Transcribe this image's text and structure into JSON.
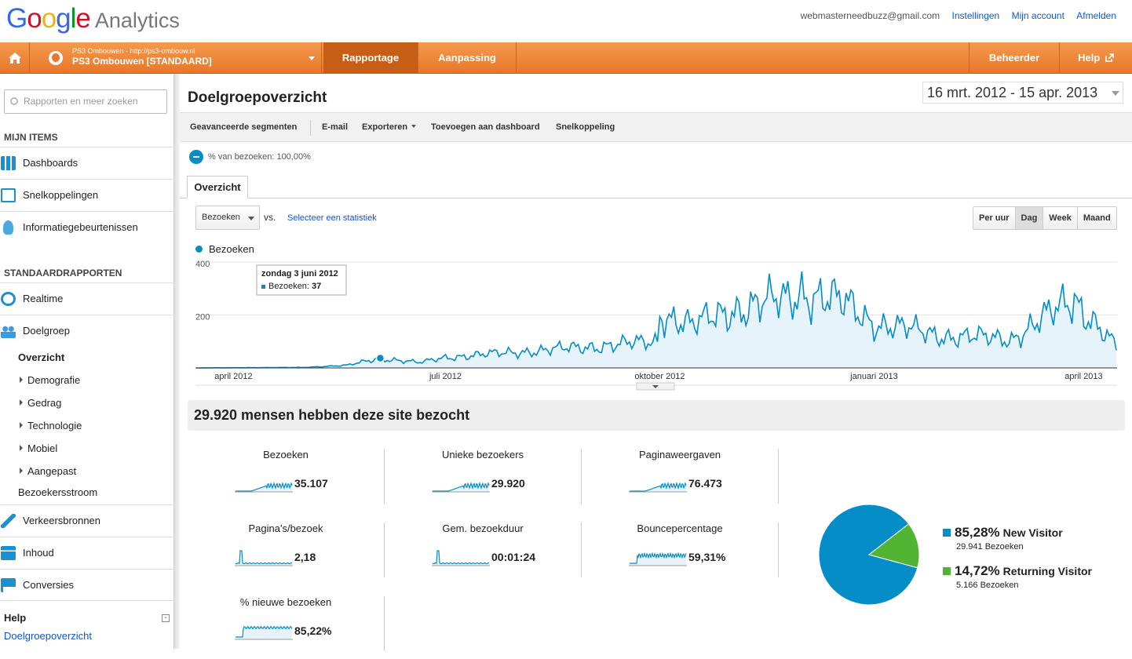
{
  "header": {
    "logo_google": "Google",
    "logo_product": "Analytics",
    "email": "webmasterneedbuzz@gmail.com",
    "links": [
      "Instellingen",
      "Mijn account",
      "Afmelden"
    ]
  },
  "nav": {
    "property_small": "PS3 Ombouwen - http://ps3-ombouw.nl",
    "property_name": "PS3 Ombouwen [STANDAARD]",
    "tab_reporting": "Rapportage",
    "tab_customization": "Aanpassing",
    "admin": "Beheerder",
    "help": "Help",
    "accent": "#e8772a"
  },
  "sidebar": {
    "search_placeholder": "Rapporten en meer zoeken",
    "my_items_title": "MIJN ITEMS",
    "my_items": [
      {
        "label": "Dashboards",
        "icon": "dashboard-icon"
      },
      {
        "label": "Snelkoppelingen",
        "icon": "shortcut-icon"
      },
      {
        "label": "Informatiegebeurtenissen",
        "icon": "lightbulb-icon"
      }
    ],
    "standard_title": "STANDAARDRAPPORTEN",
    "standard": [
      {
        "label": "Realtime",
        "icon": "realtime-icon"
      },
      {
        "label": "Doelgroep",
        "icon": "audience-icon"
      }
    ],
    "audience_sub": {
      "overview": "Overzicht",
      "items": [
        "Demografie",
        "Gedrag",
        "Technologie",
        "Mobiel",
        "Aangepast"
      ],
      "flow": "Bezoekersstroom"
    },
    "other": [
      {
        "label": "Verkeersbronnen",
        "icon": "traffic-icon"
      },
      {
        "label": "Inhoud",
        "icon": "content-icon"
      },
      {
        "label": "Conversies",
        "icon": "flag-icon"
      }
    ],
    "help_title": "Help",
    "help_link": "Doelgroepoverzicht"
  },
  "main": {
    "title": "Doelgroepoverzicht",
    "date_range": "16 mrt. 2012 - 15 apr. 2013",
    "toolbar": [
      "Geavanceerde segmenten",
      "E-mail",
      "Exporteren",
      "Toevoegen aan dashboard",
      "Snelkoppeling"
    ],
    "segment": "% van bezoeken: 100,00%",
    "tab": "Overzicht",
    "metric_select": "Bezoeken",
    "vs": "vs.",
    "select_stat": "Selecteer een statistiek",
    "granularity": [
      "Per uur",
      "Dag",
      "Week",
      "Maand"
    ],
    "granularity_active": "Dag",
    "summary": "29.920 mensen hebben deze site bezocht"
  },
  "chart_data": {
    "type": "line",
    "series": [
      {
        "name": "Bezoeken"
      }
    ],
    "y_ticks": [
      "400",
      "200"
    ],
    "ylim": [
      0,
      400
    ],
    "x_tick_labels": [
      "april 2012",
      "juli 2012",
      "oktober 2012",
      "januari 2013",
      "april 2013"
    ],
    "x_range": [
      "2012-03-16",
      "2013-04-15"
    ],
    "line_color": "#058dc7",
    "fill_color": "#e6f3fa",
    "tooltip": {
      "date": "zondag 3 juni 2012",
      "label": "Bezoeken:",
      "value": "37"
    },
    "approx_values": [
      {
        "date": "2012-03-16",
        "value": 0
      },
      {
        "date": "2012-05-01",
        "value": 2
      },
      {
        "date": "2012-05-20",
        "value": 10
      },
      {
        "date": "2012-06-03",
        "value": 37
      },
      {
        "date": "2012-06-20",
        "value": 20
      },
      {
        "date": "2012-07-01",
        "value": 40
      },
      {
        "date": "2012-08-01",
        "value": 60
      },
      {
        "date": "2012-09-01",
        "value": 80
      },
      {
        "date": "2012-09-30",
        "value": 100
      },
      {
        "date": "2012-10-01",
        "value": 210
      },
      {
        "date": "2012-10-15",
        "value": 160
      },
      {
        "date": "2012-11-01",
        "value": 220
      },
      {
        "date": "2012-11-25",
        "value": 260
      },
      {
        "date": "2012-12-01",
        "value": 290
      },
      {
        "date": "2012-12-20",
        "value": 240
      },
      {
        "date": "2013-01-01",
        "value": 170
      },
      {
        "date": "2013-02-01",
        "value": 120
      },
      {
        "date": "2013-03-01",
        "value": 110
      },
      {
        "date": "2013-03-28",
        "value": 260
      },
      {
        "date": "2013-04-15",
        "value": 80
      }
    ]
  },
  "metrics": [
    {
      "label": "Bezoeken",
      "value": "35.107"
    },
    {
      "label": "Unieke bezoekers",
      "value": "29.920"
    },
    {
      "label": "Paginaweergaven",
      "value": "76.473"
    },
    {
      "label": "Pagina's/bezoek",
      "value": "2,18"
    },
    {
      "label": "Gem. bezoekduur",
      "value": "00:01:24"
    },
    {
      "label": "Bouncepercentage",
      "value": "59,31%"
    },
    {
      "label": "% nieuwe bezoeken",
      "value": "85,22%"
    }
  ],
  "visitor_pie": {
    "type": "pie",
    "slices": [
      {
        "pct": "85,28%",
        "name": "New Visitor",
        "count": "29.941 Bezoeken",
        "value": 85.28,
        "color": "#058dc7"
      },
      {
        "pct": "14,72%",
        "name": "Returning Visitor",
        "count": "5.166 Bezoeken",
        "value": 14.72,
        "color": "#50b432"
      }
    ]
  }
}
